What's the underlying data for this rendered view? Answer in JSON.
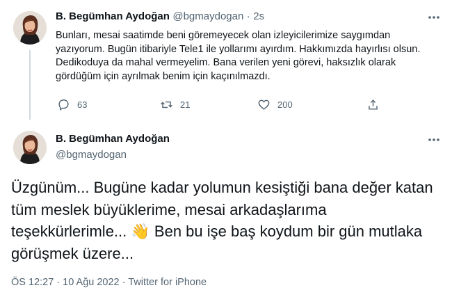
{
  "tweet1": {
    "author_name": "B. Begümhan Aydoğan",
    "handle": "@bgmaydogan",
    "separator": "·",
    "time_ago": "2s",
    "more_icon": "more-horizontal-icon",
    "text": "Bunları, mesai saatimde beni göremeyecek olan izleyicilerimize saygımdan yazıyorum. Bugün itibariyle Tele1 ile yollarımı ayırdım. Hakkımızda hayırlısı olsun. Dedikoduya da mahal vermeyelim. Bana verilen yeni görevi, haksızlık olarak gördüğüm için ayrılmak benim için kaçınılmazdı.",
    "actions": {
      "reply_count": "63",
      "retweet_count": "21",
      "like_count": "200"
    }
  },
  "tweet2": {
    "author_name": "B. Begümhan Aydoğan",
    "handle": "@bgmaydogan",
    "more_icon": "more-horizontal-icon",
    "text_part1": "Üzgünüm... Bugüne kadar yolumun kesiştiği bana değer katan tüm meslek büyüklerime, mesai arkadaşlarıma teşekkürlerimle...",
    "emoji": "👋",
    "text_part2": " Ben bu işe baş koydum bir gün mutlaka görüşmek üzere...",
    "time": "ÖS 12:27",
    "date": "10 Ağu 2022",
    "source": "Twitter for iPhone",
    "meta_separator": "·"
  },
  "colors": {
    "text_primary": "#0f1419",
    "text_secondary": "#536471",
    "thread_line": "#cfd9de",
    "background": "#ffffff"
  }
}
